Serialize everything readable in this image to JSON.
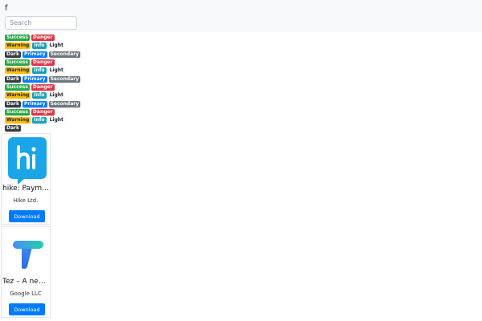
{
  "navbar": {
    "brand": "f",
    "search_placeholder": "Search"
  },
  "badge_rows": [
    [
      "Success",
      "Danger"
    ],
    [
      "Warning",
      "Info",
      "Light"
    ],
    [
      "Dark",
      "Primary",
      "Secondary"
    ],
    [
      "Success",
      "Danger"
    ],
    [
      "Warning",
      "Info",
      "Light"
    ],
    [
      "Dark",
      "Primary",
      "Secondary"
    ],
    [
      "Success",
      "Danger"
    ],
    [
      "Warning",
      "Info",
      "Light"
    ],
    [
      "Dark",
      "Primary",
      "Secondary"
    ],
    [
      "Success",
      "Danger"
    ],
    [
      "Warning",
      "Info",
      "Light"
    ],
    [
      "Dark"
    ]
  ],
  "apps": [
    {
      "title": "hike: Payme...",
      "developer": "Hike Ltd.",
      "button": "Download",
      "icon": "hike-logo-icon"
    },
    {
      "title": "Tez – A new ...",
      "developer": "Google LLC",
      "button": "Download",
      "icon": "tez-logo-icon"
    }
  ],
  "colors": {
    "success": "#28a745",
    "danger": "#dc3545",
    "warning": "#ffc107",
    "info": "#17a2b8",
    "light": "#f8f9fa",
    "dark": "#343a40",
    "primary": "#007bff",
    "secondary": "#6c757d"
  }
}
